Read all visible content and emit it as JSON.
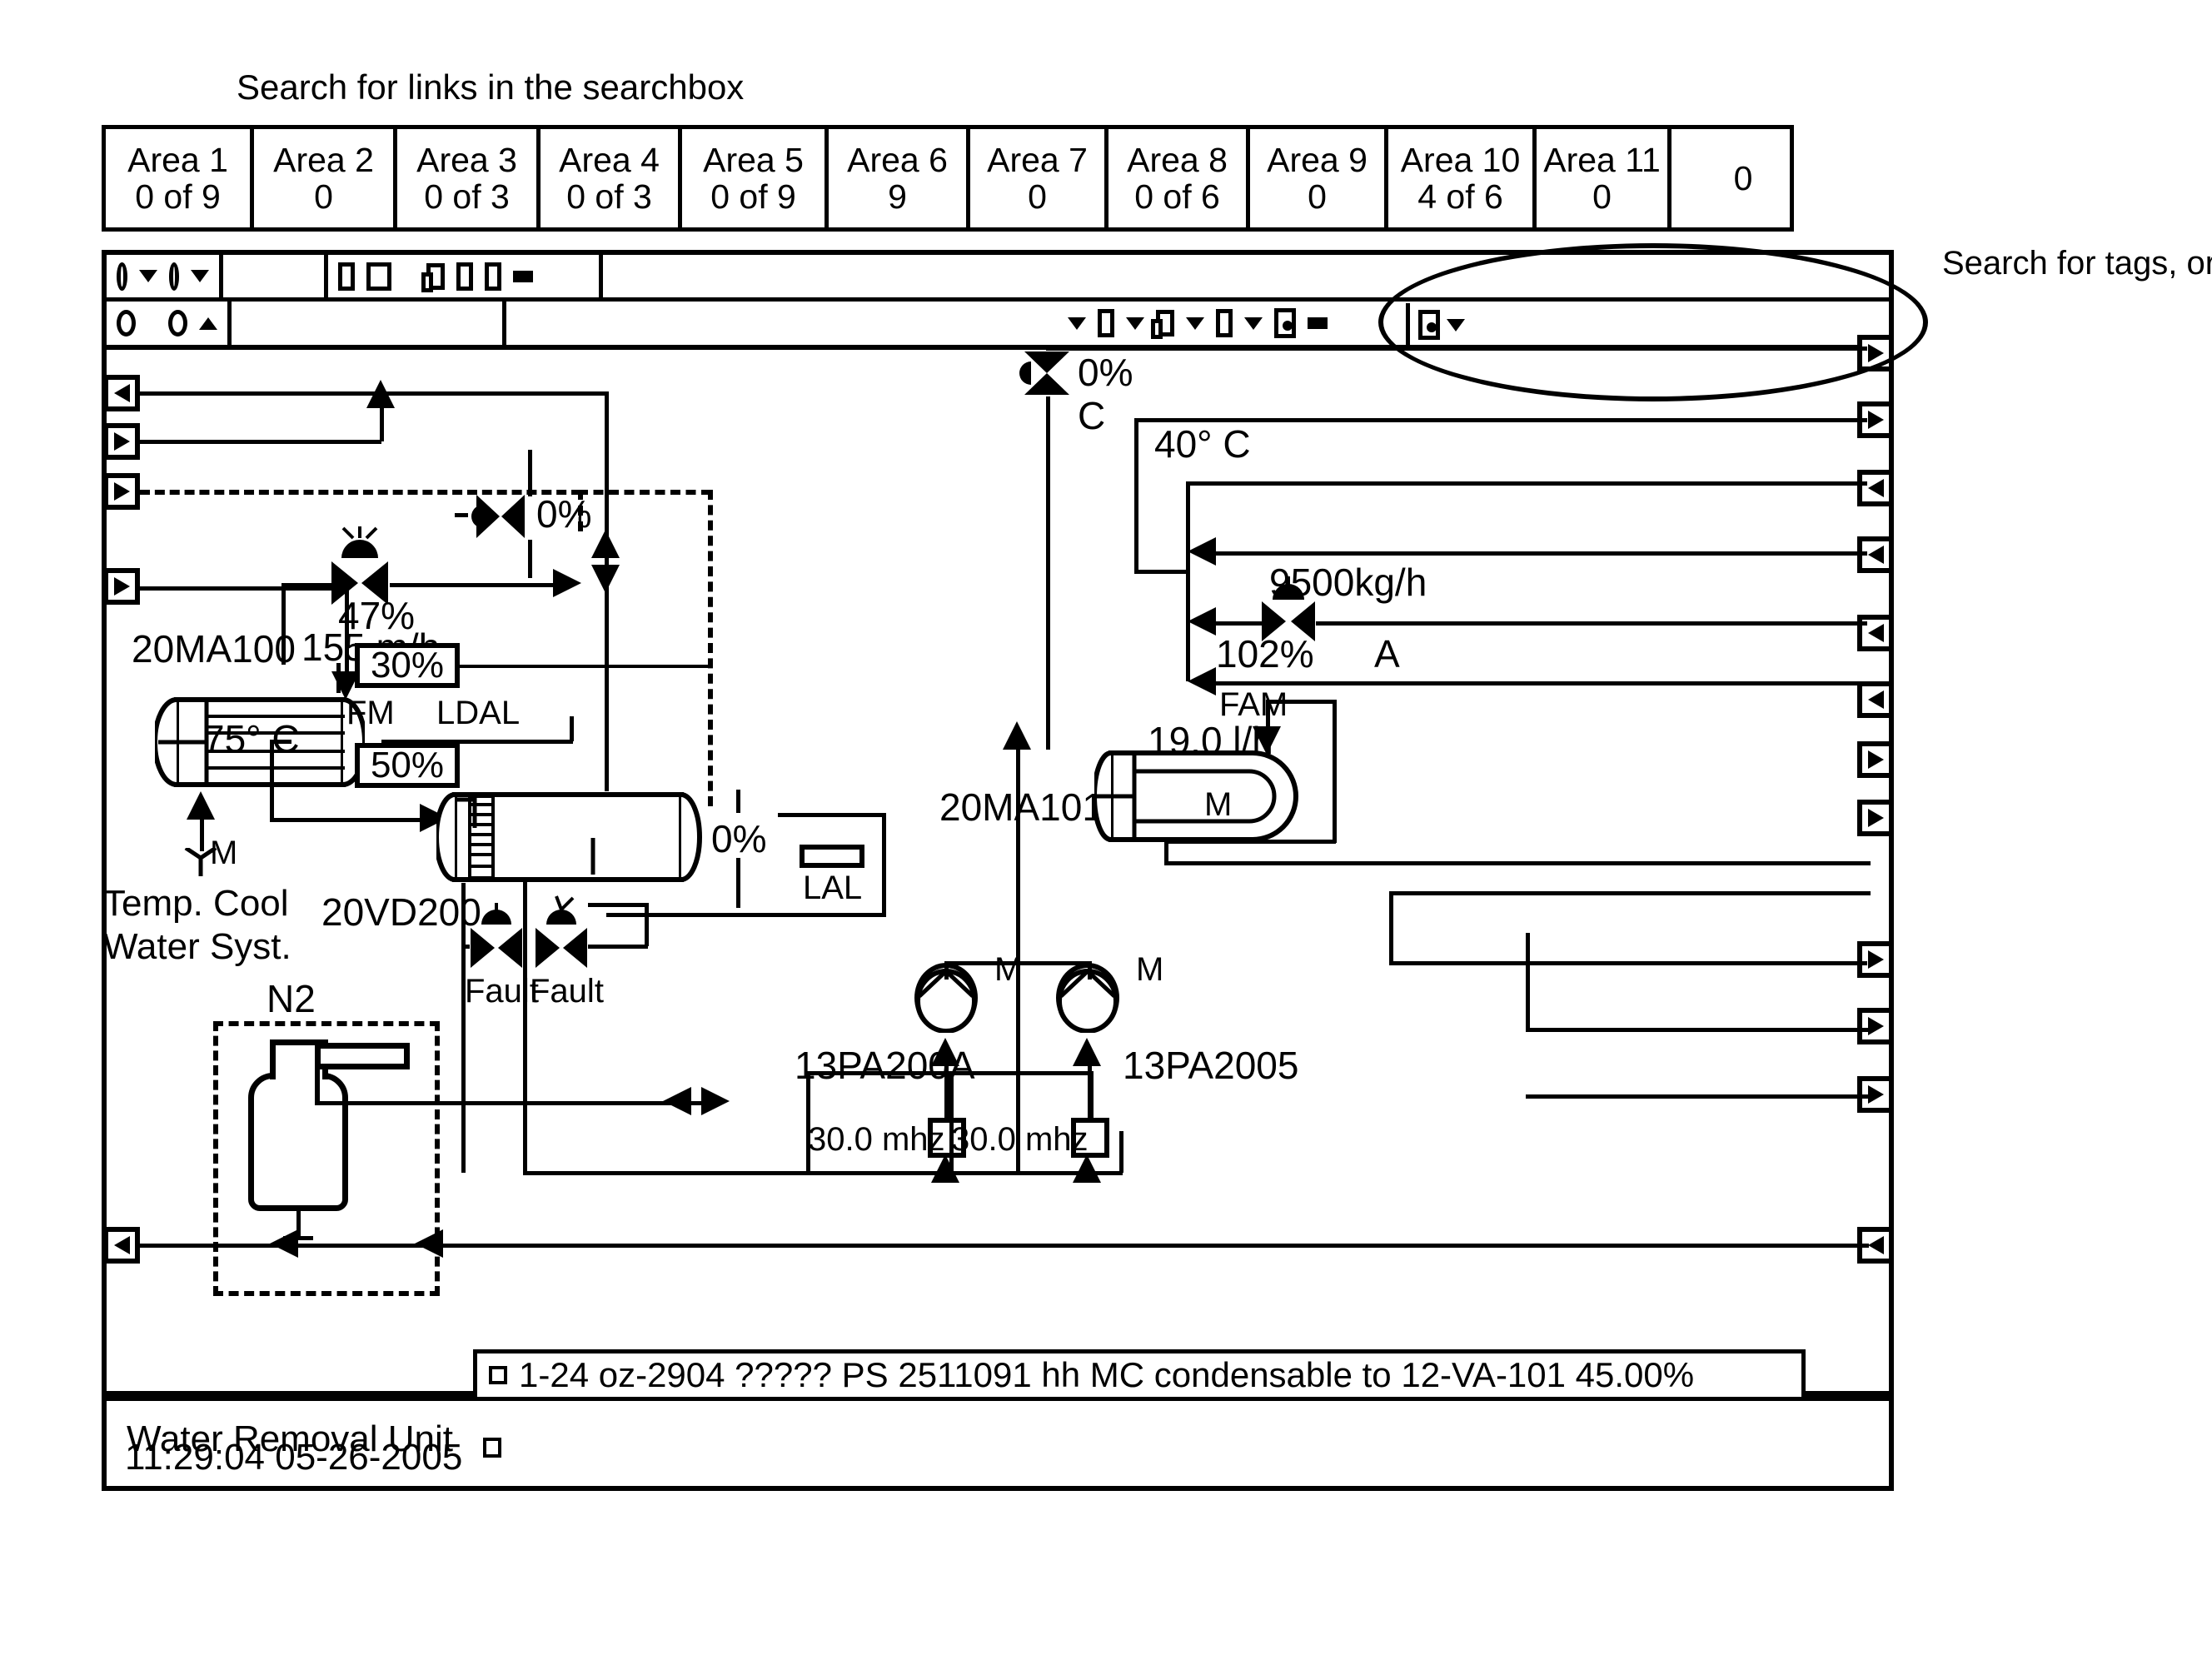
{
  "hints": {
    "top": "Search for links in the searchbox",
    "right": "Search for tags, or for text from the description or notes field"
  },
  "area_tabs": [
    {
      "name": "Area 1",
      "count": "0 of 9"
    },
    {
      "name": "Area 2",
      "count": "0"
    },
    {
      "name": "Area 3",
      "count": "0 of 3"
    },
    {
      "name": "Area 4",
      "count": "0 of 3"
    },
    {
      "name": "Area 5",
      "count": "0 of 9"
    },
    {
      "name": "Area 6",
      "count": "9"
    },
    {
      "name": "Area 7",
      "count": "0"
    },
    {
      "name": "Area 8",
      "count": "0 of 6"
    },
    {
      "name": "Area 9",
      "count": "0"
    },
    {
      "name": "Area 10",
      "count": "4 of 6"
    },
    {
      "name": "Area 11",
      "count": "0"
    },
    {
      "name": "",
      "count": "0"
    }
  ],
  "toolbar": {
    "row1_icons": [
      "circle-dropdown-icon",
      "circle-dropdown-icon",
      "page-icon",
      "page-filled-icon",
      "copy-icon",
      "page-icon",
      "page-icon",
      "bar-icon"
    ],
    "row2_icons": [
      "circle-icon",
      "circle-up-icon",
      "chevron-down-icon",
      "page-icon",
      "chevron-down-icon",
      "copy-icon",
      "chevron-down-icon",
      "page-icon",
      "chevron-down-icon",
      "record-icon",
      "bar-icon"
    ]
  },
  "search_box": {
    "value": "",
    "placeholder": ""
  },
  "diagram": {
    "unit_title": "Water Removal Unit",
    "equipment": {
      "hx_left_tag": "20MA100",
      "hx_right_tag": "20MA101",
      "vessel_tag": "20VD200",
      "pump_a_tag": "13PA200A",
      "pump_b_tag": "13PA2005",
      "n2_tag": "N2",
      "cool_water_label": "Temp. Cool Water Syst."
    },
    "readings": {
      "valve_top_mid": "0%",
      "valve_left": "47%",
      "flow_left": "155 m/h",
      "temp_left": "75° C",
      "fm_value": "30%",
      "fm_label": "FM",
      "ldal_label": "LDAL",
      "ldal_value": "50%",
      "vessel_level": "0%",
      "lal_label": "LAL",
      "valve_top_right": "0%",
      "valve_top_right_sub": "C",
      "temp_right": "40° C",
      "flow_right_mass": "9500kg/h",
      "valve_right_pos": "102%",
      "valve_right_letter": "A",
      "fam_label": "FAM",
      "flow_hx_right": "19.0 l/h",
      "motor_label": "M",
      "motor_label_left": "M",
      "fault_a": "Fault",
      "fault_b": "Fault",
      "pump_a_speed": "30.0  mhz",
      "pump_b_speed": "30.0  mhz"
    }
  },
  "status": {
    "clock": "11:29:04   05-26-2005",
    "message": "1-24 oz-2904 ????? PS 2511091 hh MC condensable to 12-VA-101   45.00%"
  }
}
